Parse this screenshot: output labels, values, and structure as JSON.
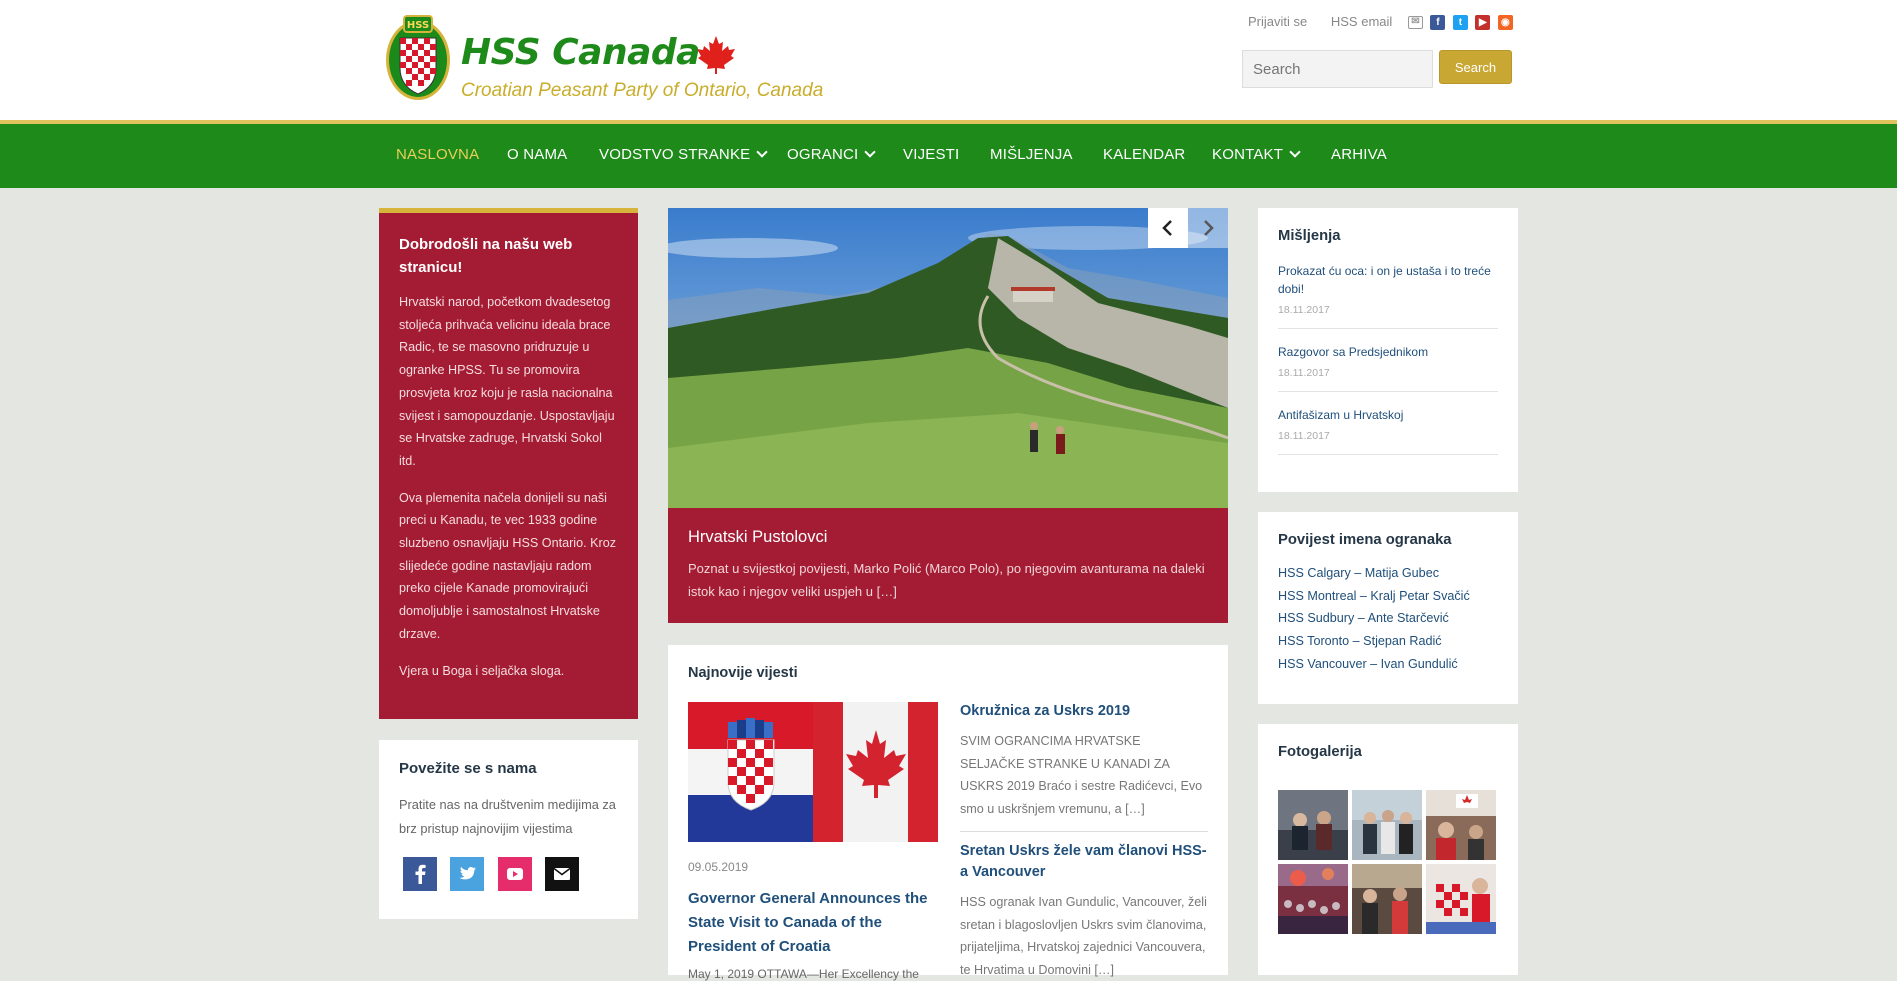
{
  "header": {
    "logo_title": "HSS Canada",
    "logo_subtitle": "Croatian Peasant Party of Ontario, Canada",
    "emblem_text": "HSS",
    "login_link": "Prijaviti se",
    "email_link": "HSS email",
    "social_icons": [
      "mail-icon",
      "facebook-icon",
      "twitter-icon",
      "youtube-icon",
      "rss-icon"
    ],
    "search_placeholder": "Search",
    "search_button": "Search"
  },
  "nav": {
    "items": [
      {
        "label": "NASLOVNA",
        "active": true,
        "dropdown": false
      },
      {
        "label": "O NAMA",
        "active": false,
        "dropdown": false
      },
      {
        "label": "VODSTVO STRANKE",
        "active": false,
        "dropdown": true
      },
      {
        "label": "OGRANCI",
        "active": false,
        "dropdown": true
      },
      {
        "label": "VIJESTI",
        "active": false,
        "dropdown": false
      },
      {
        "label": "MIŠLJENJA",
        "active": false,
        "dropdown": false
      },
      {
        "label": "KALENDAR",
        "active": false,
        "dropdown": false
      },
      {
        "label": "KONTAKT",
        "active": false,
        "dropdown": true
      },
      {
        "label": "ARHIVA",
        "active": false,
        "dropdown": false
      }
    ]
  },
  "welcome": {
    "title": "Dobrodošli na našu web stranicu!",
    "paragraphs": [
      "Hrvatski narod, početkom dvadesetog stoljeća prihvaća velicinu ideala brace Radic, te se masovno pridruzuje u ogranke HPSS. Tu se promovira prosvjeta kroz koju je rasla nacionalna svijest i samopouzdanje. Uspostavljaju se Hrvatske zadruge, Hrvatski Sokol itd.",
      "Ova plemenita načela donijeli su naši preci u Kanadu, te vec 1933 godine sluzbeno osnavljaju HSS Ontario. Kroz slijedeće godine nastavljaju radom preko cijele Kanade promovirajući domoljublje i samostalnost Hrvatske drzave.",
      "Vjera u Boga i seljačka sloga."
    ]
  },
  "connect": {
    "title": "Povežite se s nama",
    "text": "Pratite nas na društvenim medijima za brz pristup najnovijim vijestima",
    "icons": [
      "facebook-icon",
      "twitter-icon",
      "youtube-icon",
      "email-icon"
    ]
  },
  "slider": {
    "caption_title": "Hrvatski Pustolovci",
    "caption_text": "Poznat u svijestkoj povijesti, Marko Polić (Marco Polo), po njegovim avanturama na daleki istok kao i njegov veliki uspjeh u […]"
  },
  "news": {
    "title": "Najnovije vijesti",
    "main": {
      "date": "09.05.2019",
      "title": "Governor General Announces the State Visit to Canada of the President of Croatia",
      "excerpt": "May 1, 2019 OTTAWA—Her Excellency the"
    },
    "side": [
      {
        "title": "Okružnica za Uskrs 2019",
        "excerpt": "SVIM OGRANCIMA HRVATSKE SELJAČKE STRANKE U KANADI ZA USKRS 2019 Braćo i sestre Radićevci, Evo smo u uskršnjem vremunu, a […]"
      },
      {
        "title": "Sretan Uskrs želе vam članovi HSS-a Vancouver",
        "excerpt": "HSS ogranak Ivan Gundulic, Vancouver, želi sretan i blagoslovljen Uskrs svim članovima, prijateljima, Hrvatskoj zajednici Vancouvera, te Hrvatima u Domovini […]"
      }
    ]
  },
  "opinions": {
    "title": "Mišljenja",
    "items": [
      {
        "title": "Prokazat ću oca: i on je ustaša i to treće dobi!",
        "date": "18.11.2017"
      },
      {
        "title": "Razgovor sa Predsjednikom",
        "date": "18.11.2017"
      },
      {
        "title": "Antifašizam u Hrvatskoj",
        "date": "18.11.2017"
      }
    ]
  },
  "history": {
    "title": "Povijest imena ogranaka",
    "items": [
      "HSS Calgary – Matija Gubec",
      "HSS Montreal – Kralj Petar Svačić",
      "HSS Sudbury – Ante Starčević",
      "HSS Toronto – Stjepan Radić",
      "HSS Vancouver – Ivan Gundulić"
    ]
  },
  "gallery": {
    "title": "Fotogalerija"
  },
  "colors": {
    "nav_green": "#1e8a1a",
    "accent_gold": "#c9a733",
    "welcome_red": "#a41c34",
    "link_blue": "#1f4f7a"
  }
}
